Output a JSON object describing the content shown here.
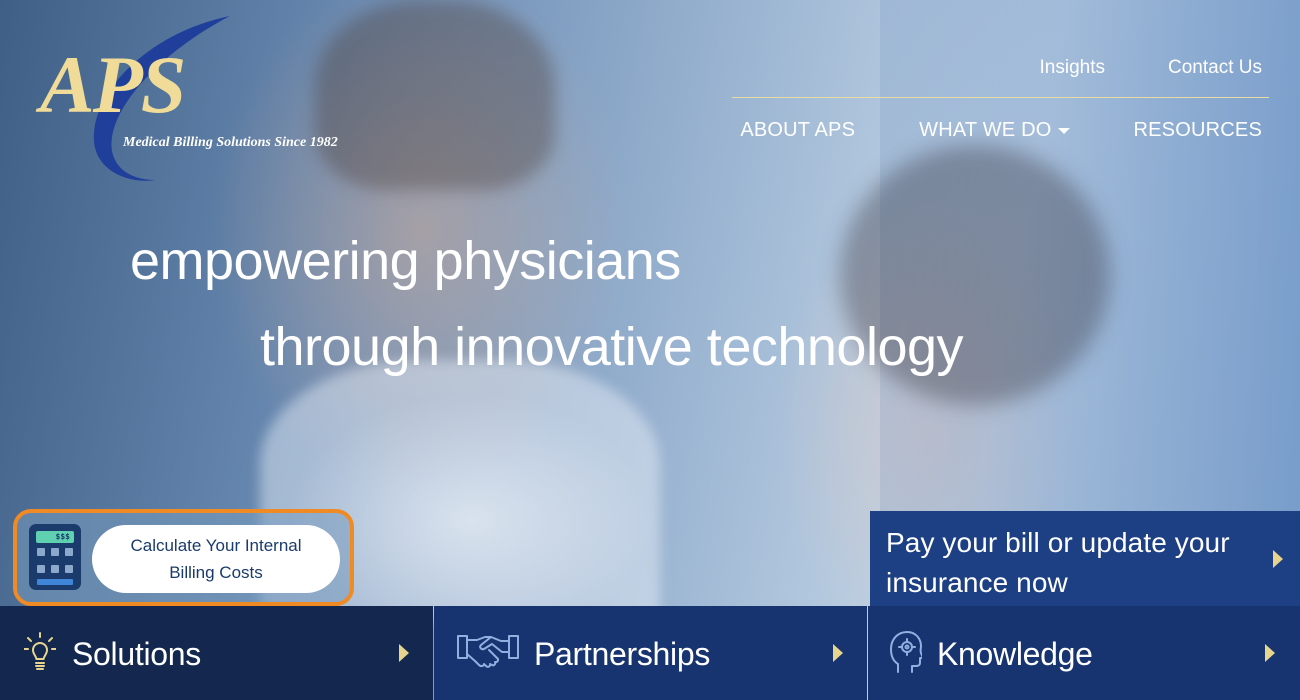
{
  "logo": {
    "brand": "APS",
    "tagline": "Medical Billing Solutions Since 1982"
  },
  "top_nav": {
    "items": [
      {
        "label": "Insights"
      },
      {
        "label": "Contact Us"
      }
    ]
  },
  "main_nav": {
    "items": [
      {
        "label": "ABOUT APS"
      },
      {
        "label": "WHAT WE DO",
        "has_dropdown": true
      },
      {
        "label": "RESOURCES"
      }
    ]
  },
  "hero": {
    "headline_line1": "empowering physicians",
    "headline_line2": "through innovative technology"
  },
  "calculator": {
    "screen_text": "$$$",
    "button_label": "Calculate Your Internal Billing Costs",
    "icon": "calculator-icon"
  },
  "pay_panel": {
    "text": "Pay your bill or update your insurance now",
    "icon": "arrow-right-icon"
  },
  "tiles": [
    {
      "label": "Solutions",
      "icon": "lightbulb-icon"
    },
    {
      "label": "Partnerships",
      "icon": "handshake-icon"
    },
    {
      "label": "Knowledge",
      "icon": "brain-head-icon"
    }
  ],
  "colors": {
    "brand_gold": "#f0dc98",
    "brand_navy": "#1b3b6c",
    "tile_blue": "#173470",
    "tile_dark": "#14284f",
    "cta_outline": "#f08a24",
    "arrow_gold": "#e7d58e"
  }
}
